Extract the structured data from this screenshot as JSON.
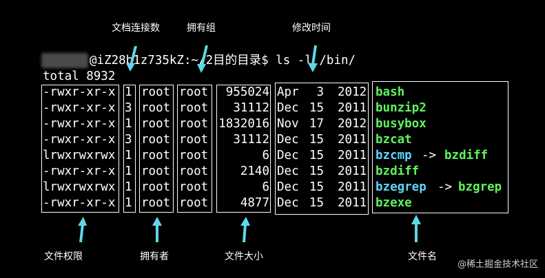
{
  "annotations": {
    "link_count": "文档连接数",
    "group": "拥有组",
    "modify_time": "修改时间",
    "permissions": "文件权限",
    "owner": "拥有者",
    "size": "文件大小",
    "filename": "文件名"
  },
  "terminal": {
    "prompt": "@iZ28b1z735kZ:~/2目的目录$ ls -l /bin/",
    "total": "total 8932",
    "rows": [
      {
        "perm": "-rwxr-xr-x",
        "links": "1",
        "owner": "root",
        "group": "root",
        "size": "955024",
        "month": "Apr",
        "day": "3",
        "year": "2012",
        "name": "bash",
        "arrow": "",
        "target": ""
      },
      {
        "perm": "-rwxr-xr-x",
        "links": "3",
        "owner": "root",
        "group": "root",
        "size": "31112",
        "month": "Dec",
        "day": "15",
        "year": "2011",
        "name": "bunzip2",
        "arrow": "",
        "target": ""
      },
      {
        "perm": "-rwxr-xr-x",
        "links": "1",
        "owner": "root",
        "group": "root",
        "size": "1832016",
        "month": "Nov",
        "day": "17",
        "year": "2012",
        "name": "busybox",
        "arrow": "",
        "target": ""
      },
      {
        "perm": "-rwxr-xr-x",
        "links": "3",
        "owner": "root",
        "group": "root",
        "size": "31112",
        "month": "Dec",
        "day": "15",
        "year": "2011",
        "name": "bzcat",
        "arrow": "",
        "target": ""
      },
      {
        "perm": "lrwxrwxrwx",
        "links": "1",
        "owner": "root",
        "group": "root",
        "size": "6",
        "month": "Dec",
        "day": "15",
        "year": "2011",
        "name": "bzcmp",
        "arrow": "->",
        "target": "bzdiff"
      },
      {
        "perm": "-rwxr-xr-x",
        "links": "1",
        "owner": "root",
        "group": "root",
        "size": "2140",
        "month": "Dec",
        "day": "15",
        "year": "2011",
        "name": "bzdiff",
        "arrow": "",
        "target": ""
      },
      {
        "perm": "lrwxrwxrwx",
        "links": "1",
        "owner": "root",
        "group": "root",
        "size": "6",
        "month": "Dec",
        "day": "15",
        "year": "2011",
        "name": "bzegrep",
        "arrow": "->",
        "target": "bzgrep"
      },
      {
        "perm": "-rwxr-xr-x",
        "links": "1",
        "owner": "root",
        "group": "root",
        "size": "4877",
        "month": "Dec",
        "day": "15",
        "year": "2011",
        "name": "bzexe",
        "arrow": "",
        "target": ""
      }
    ]
  },
  "colors": {
    "executable": "#5ff55f",
    "symlink": "#5fd7ff",
    "arrow": "#5fd7ff"
  },
  "watermark": "@稀土掘金技术社区"
}
